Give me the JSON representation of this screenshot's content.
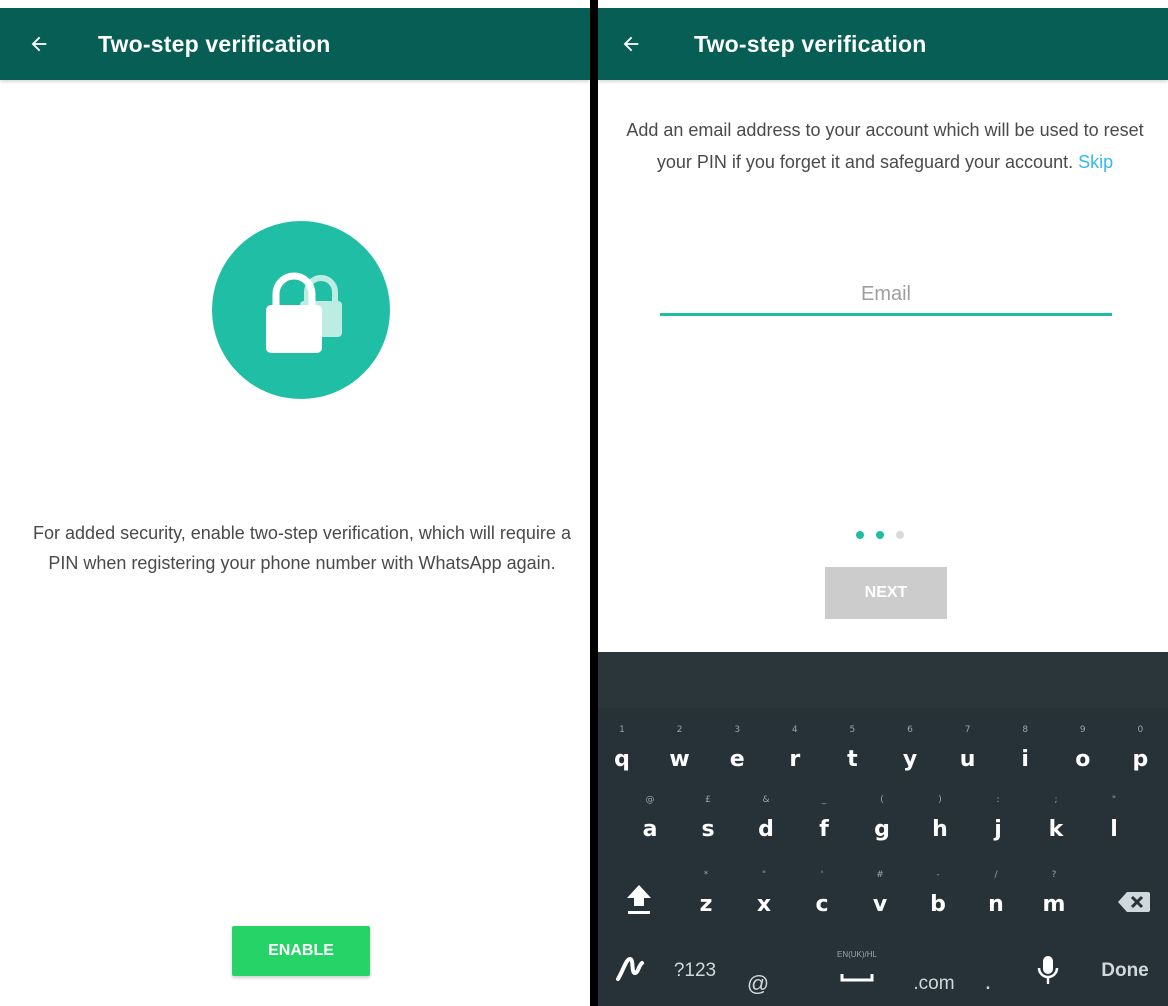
{
  "left_screen": {
    "title": "Two-step verification",
    "description": "For added security, enable two-step verification, which will require a PIN when registering your phone number with WhatsApp again.",
    "enable_label": "ENABLE"
  },
  "right_screen": {
    "title": "Two-step verification",
    "description": "Add an email address to your account which will be used to reset your PIN if you forget it and safeguard your account.",
    "skip_label": "Skip",
    "email_placeholder": "Email",
    "email_value": "",
    "next_label": "NEXT",
    "step_dots": {
      "total": 3,
      "current": 2
    }
  },
  "keyboard": {
    "row1": [
      {
        "key": "q",
        "hint": "1"
      },
      {
        "key": "w",
        "hint": "2"
      },
      {
        "key": "e",
        "hint": "3"
      },
      {
        "key": "r",
        "hint": "4"
      },
      {
        "key": "t",
        "hint": "5"
      },
      {
        "key": "y",
        "hint": "6"
      },
      {
        "key": "u",
        "hint": "7"
      },
      {
        "key": "i",
        "hint": "8"
      },
      {
        "key": "o",
        "hint": "9"
      },
      {
        "key": "p",
        "hint": "0"
      }
    ],
    "row2": [
      {
        "key": "a",
        "hint": "@"
      },
      {
        "key": "s",
        "hint": "£"
      },
      {
        "key": "d",
        "hint": "&"
      },
      {
        "key": "f",
        "hint": "_"
      },
      {
        "key": "g",
        "hint": "("
      },
      {
        "key": "h",
        "hint": ")"
      },
      {
        "key": "j",
        "hint": ":"
      },
      {
        "key": "k",
        "hint": ";"
      },
      {
        "key": "l",
        "hint": "\""
      }
    ],
    "row3": [
      {
        "key": "z",
        "hint": "*"
      },
      {
        "key": "x",
        "hint": "\""
      },
      {
        "key": "c",
        "hint": "'"
      },
      {
        "key": "v",
        "hint": "#"
      },
      {
        "key": "b",
        "hint": "-"
      },
      {
        "key": "n",
        "hint": "/"
      },
      {
        "key": "m",
        "hint": "?"
      }
    ],
    "symbols_label": "?123",
    "at_label": "@",
    "space_hint": "EN(UK)/HL",
    "dotcom_label": ".com",
    "period_label": ".",
    "done_label": "Done"
  },
  "colors": {
    "app_bar": "#075e54",
    "teal_accent": "#1ebea5",
    "lock_circle": "#20bfa5",
    "enable_button": "#25d366",
    "link": "#34b7f1",
    "next_disabled": "#cccccc",
    "keyboard_bg": "#263238",
    "dot_active": "#1ebea5",
    "dot_inactive": "#d9d9d9"
  },
  "icons": {
    "back": "arrow-left-icon",
    "lock": "padlock-icon",
    "shift": "shift-arrow-icon",
    "backspace": "backspace-icon",
    "swype": "swype-logo-icon",
    "space": "spacebar-icon",
    "microphone": "microphone-icon"
  }
}
